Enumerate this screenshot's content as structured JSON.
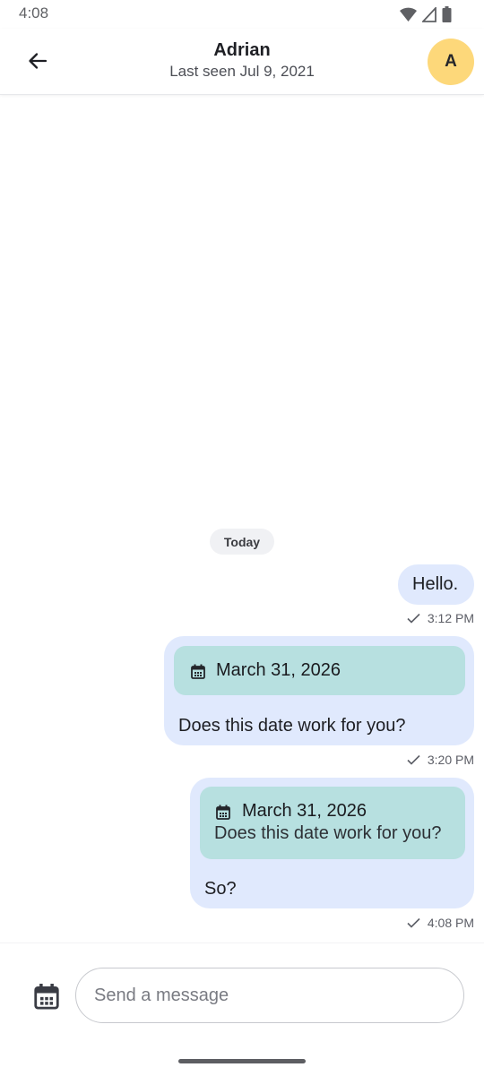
{
  "status_bar": {
    "time": "4:08",
    "icons": [
      "wifi-icon",
      "cellular-signal-icon",
      "battery-icon"
    ]
  },
  "header": {
    "back_icon": "arrow-left-icon",
    "title": "Adrian",
    "subtitle": "Last seen Jul 9, 2021",
    "avatar_initial": "A",
    "avatar_color": "#fdd87a"
  },
  "conversation": {
    "date_separator": "Today",
    "messages": [
      {
        "text": "Hello.",
        "time": "3:12 PM",
        "status_icon": "check-icon"
      },
      {
        "card_date": "March 31, 2026",
        "card_icon": "calendar-icon",
        "text": "Does this date work for you?",
        "time": "3:20 PM",
        "status_icon": "check-icon"
      },
      {
        "card_date": "March 31, 2026",
        "card_note": "Does this date work for you?",
        "card_icon": "calendar-icon",
        "text": "So?",
        "time": "4:08 PM",
        "status_icon": "check-icon"
      }
    ]
  },
  "composer": {
    "calendar_icon": "calendar-icon",
    "placeholder": "Send a message",
    "value": ""
  },
  "colors": {
    "outgoing_bubble": "#e0e9fd",
    "date_card": "#b7e0e0",
    "date_chip": "#f0f1f4"
  }
}
